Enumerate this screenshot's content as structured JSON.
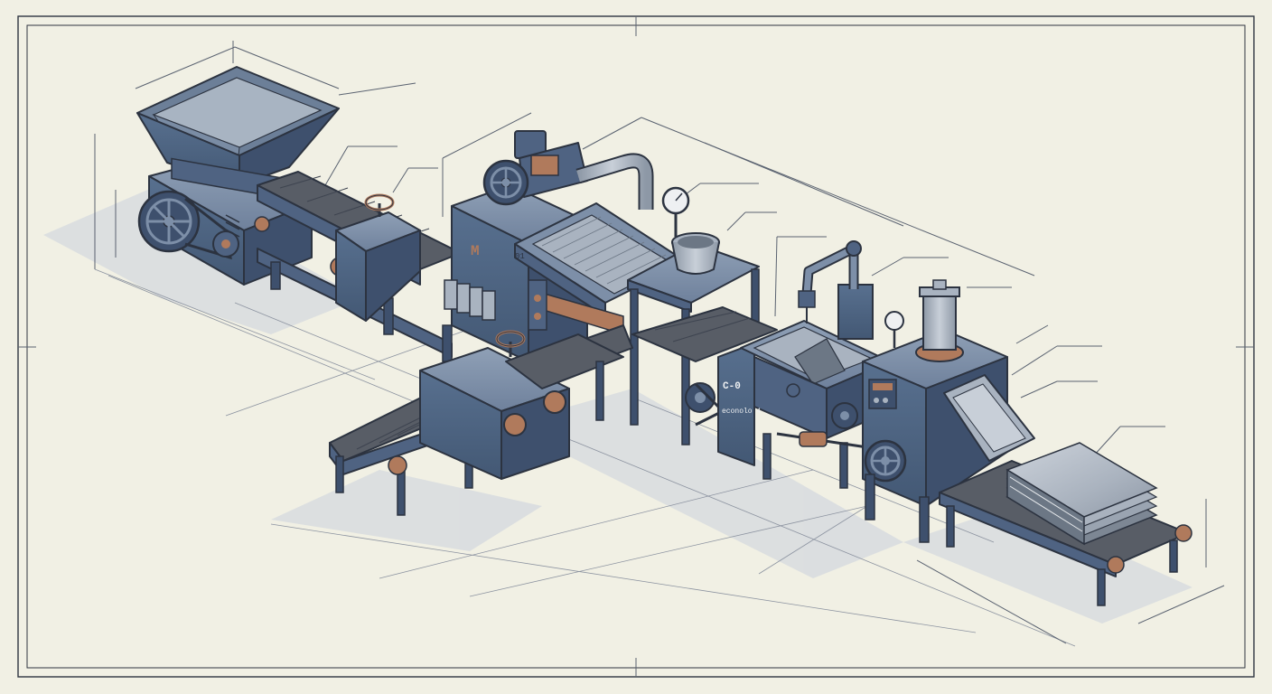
{
  "colors": {
    "paper": "#f1f0e4",
    "frame": "#2e3440",
    "machine_top": "#7d8fa8",
    "machine_front": "#4f6382",
    "machine_side": "#3e506d",
    "metal_light": "#a9b3c0",
    "belt": "#585d66",
    "copper": "#b07a5c",
    "shadow": "#d7dbe0"
  },
  "labels": {
    "motor_plate": "M",
    "panel_code": "01",
    "module_tag": "C-0",
    "module_plate": "econolo 4"
  },
  "icons": [
    "hopper-icon",
    "flywheel-icon",
    "valve-wheel-icon",
    "pressure-gauge-icon",
    "motor-icon",
    "pipe-icon",
    "robot-arm-icon",
    "hydraulic-press-icon",
    "control-panel-icon",
    "stacked-sheets-icon"
  ]
}
